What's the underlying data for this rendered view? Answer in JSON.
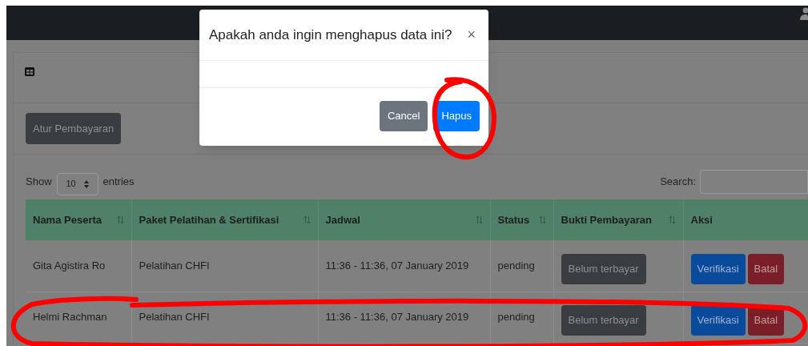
{
  "modal": {
    "title": "Apakah anda ingin menghapus data ini?",
    "close": "×",
    "buttons": [
      {
        "label": "Cancel",
        "kind": "secondary"
      },
      {
        "label": "Hapus",
        "kind": "primary"
      }
    ]
  },
  "card": {
    "action_button": "Atur Pembayaran"
  },
  "length_menu": {
    "prefix": "Show",
    "value": "10",
    "suffix": "entries"
  },
  "search": {
    "label": "Search:"
  },
  "table": {
    "columns": [
      "Nama Peserta",
      "Paket Pelatihan & Sertifikasi",
      "Jadwal",
      "Status",
      "Bukti Pembayaran",
      "Aksi"
    ],
    "rows": [
      {
        "name": "Gita Agistira Ro",
        "package": "Pelatihan CHFI",
        "schedule": "11:36 - 11:36, 07 January 2019",
        "status": "pending",
        "proof": "Belum terbayar",
        "actions": [
          {
            "label": "Verifikasi",
            "kind": "verify"
          },
          {
            "label": "Batal",
            "kind": "cancel"
          }
        ]
      },
      {
        "name": "Helmi Rachman",
        "package": "Pelatihan CHFI",
        "schedule": "11:36 - 11:36, 07 January 2019",
        "status": "pending",
        "proof": "Belum terbayar",
        "actions": [
          {
            "label": "Verifikasi",
            "kind": "verify"
          },
          {
            "label": "Batal",
            "kind": "cancel"
          }
        ]
      }
    ]
  }
}
